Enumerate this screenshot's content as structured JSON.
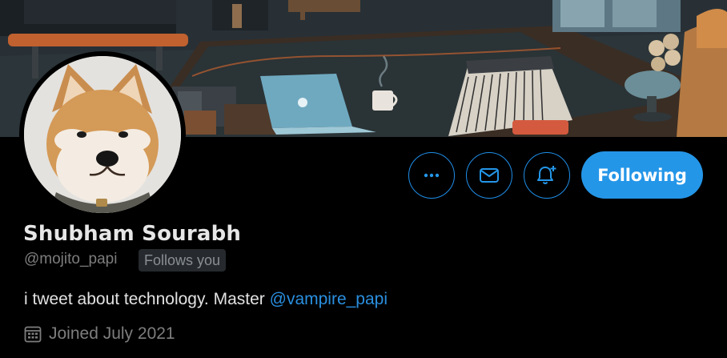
{
  "profile": {
    "name": "Shubham Sourabh",
    "handle": "@mojito_papi",
    "follows_you": "Follows you",
    "bio_text": "i tweet about technology. Master ",
    "bio_mention": "@vampire_papi",
    "joined": "Joined July 2021"
  },
  "actions": {
    "more_icon": "more-horizontal-icon",
    "message_icon": "mail-icon",
    "notify_icon": "bell-plus-icon",
    "follow_label": "Following"
  },
  "colors": {
    "accent": "#2496e8",
    "background": "#000000",
    "muted": "#7d7d7d",
    "text": "#e2e2e2"
  }
}
